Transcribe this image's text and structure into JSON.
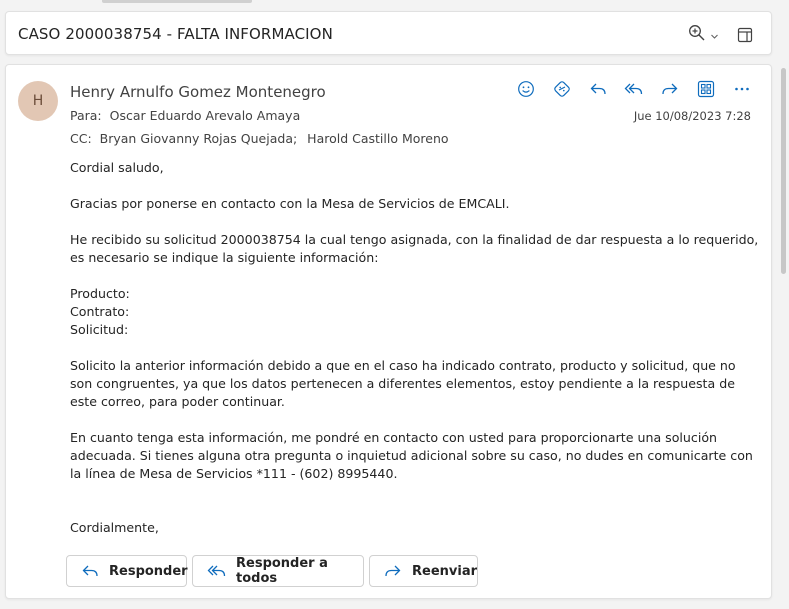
{
  "subject": {
    "text": "CASO 2000038754 - FALTA INFORMACION",
    "zoom_icon": "zoom-in-icon",
    "popout_icon": "open-in-window-icon"
  },
  "message": {
    "avatar_initial": "H",
    "avatar_color": "#e2c7b4",
    "sender": "Henry Arnulfo Gomez Montenegro",
    "to_label": "Para:",
    "to": "Oscar Eduardo Arevalo Amaya",
    "cc_label": "CC:",
    "cc": [
      "Bryan Giovanny Rojas Quejada;",
      "Harold Castillo Moreno"
    ],
    "date": "Jue 10/08/2023 7:28",
    "actions": [
      "emoji-icon",
      "sticker-icon",
      "reply-icon",
      "reply-all-icon",
      "forward-icon",
      "apps-grid-icon",
      "more-icon"
    ],
    "accent": "#0f6cbd"
  },
  "body": {
    "greeting": "Cordial saludo,",
    "p1": "Gracias por ponerse en contacto con la Mesa de Servicios de EMCALI.",
    "p2": "He recibido su solicitud 2000038754 la cual tengo asignada, con la finalidad de dar respuesta a lo requerido, es necesario se indique la siguiente información:",
    "field_producto": "Producto:",
    "field_contrato": "Contrato:",
    "field_solicitud": "Solicitud:",
    "p3": "Solicito la anterior información debido a que en el caso ha indicado contrato, producto y solicitud, que no son congruentes, ya que los datos pertenecen a diferentes elementos, estoy pendiente a la respuesta de este correo, para poder continuar.",
    "p4": "En cuanto tenga esta información, me pondré en contacto con usted para proporcionarte una solución adecuada. Si tienes alguna otra pregunta o inquietud adicional sobre su caso, no dudes en comunicarte con la línea de Mesa de Servicios *111 - (602) 8995440.",
    "closing": "Cordialmente,"
  },
  "reply_bar": {
    "reply": "Responder",
    "reply_all": "Responder a todos",
    "forward": "Reenviar"
  }
}
